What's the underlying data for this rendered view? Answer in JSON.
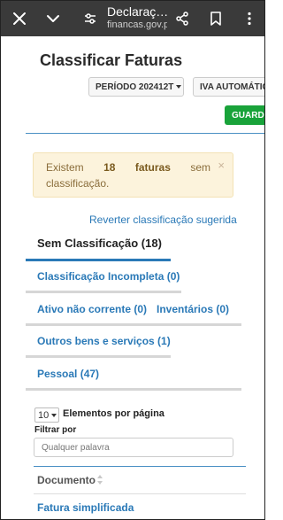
{
  "browser": {
    "title": "Declaraç…",
    "url": "financas.gov.pt"
  },
  "page": {
    "title": "Classificar Faturas",
    "period_label": "PERÍODO 202412T",
    "iva_label": "IVA AUTOMÁTIC",
    "save_label": "GUARDAR"
  },
  "alert": {
    "w1": "Existem",
    "count": "18",
    "w2": "faturas",
    "w3": "sem",
    "line2": "classificação.",
    "close": "×"
  },
  "revert_link": "Reverter classificação sugerida",
  "section": {
    "title": "Sem Classificação (18)"
  },
  "categories": {
    "incompleta": "Classificação Incompleta (0)",
    "ativo": "Ativo não corrente (0)",
    "inventarios": "Inventários (0)",
    "outros": "Outros bens e serviços (1)",
    "pessoal": "Pessoal (47)"
  },
  "table": {
    "page_size": "10",
    "page_size_label": "Elementos por página",
    "filter_label": "Filtrar por",
    "filter_placeholder": "Qualquer palavra",
    "column_document": "Documento",
    "first_row": "Fatura simplificada"
  }
}
